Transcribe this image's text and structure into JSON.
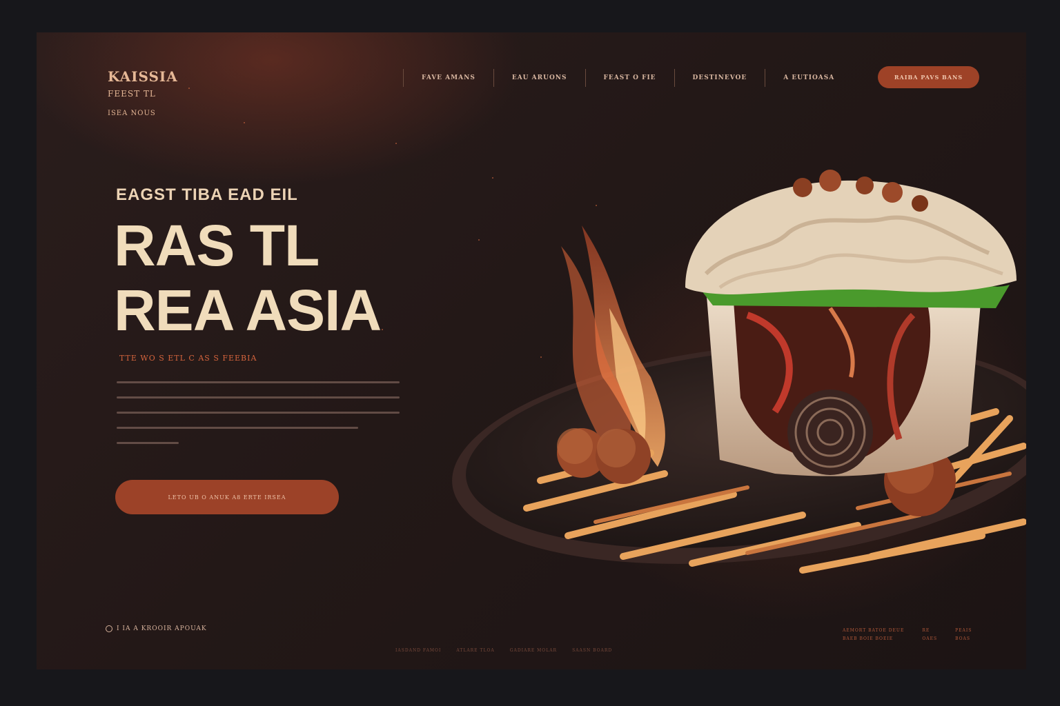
{
  "brand": {
    "title": "KAISSIA",
    "subtitle": "FEEST TL",
    "tagline": "ISEA NOUS"
  },
  "nav": {
    "items": [
      "FAVE AMANS",
      "EAU ARUONS",
      "FEAST O FIE",
      "DESTINEVOE",
      "A EUTIOASA"
    ],
    "cta_label": "RAIBA    PAVS BANS"
  },
  "hero": {
    "eyebrow": "EAGST TIBA EAD EIL",
    "headline_line1": "RAS TL",
    "headline_line2": "REA ASIA",
    "subline": "TTE WO S ETL C AS S FEEBIA",
    "cta_label": "LETO UB      O ANUK A8 ERTE IRSEA"
  },
  "footer": {
    "social_label": "I IA A  KROOIR APOUAK",
    "links": [
      "IASDAND FAMOI",
      "ATLARE TLOA",
      "GADIARE MOLAR",
      "SAASN BOARD"
    ],
    "contact_col1_l1": "AEMORT BATOE DEUE",
    "contact_col1_l2": "BAEB BOIE BOEIE",
    "contact_col2_l1": "RE",
    "contact_col2_l2": "OAES",
    "contact_col3_l1": "PEAIS",
    "contact_col3_l2": "BOAS"
  },
  "colors": {
    "accent": "#9e4227",
    "headline": "#f0dcbb",
    "background": "#231817"
  },
  "icons": {
    "social": "circle-icon"
  }
}
